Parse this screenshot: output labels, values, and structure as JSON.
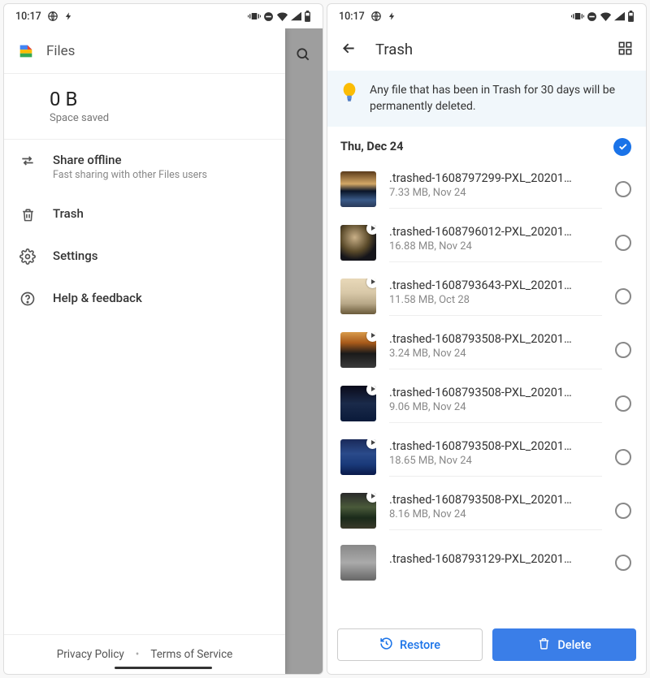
{
  "status": {
    "time": "10:17"
  },
  "left": {
    "header": {
      "title": "Files"
    },
    "space": {
      "value": "0 B",
      "label": "Space saved"
    },
    "items": [
      {
        "icon": "swap",
        "label": "Share offline",
        "sub": "Fast sharing with other Files users"
      },
      {
        "icon": "trash",
        "label": "Trash",
        "sub": ""
      },
      {
        "icon": "gear",
        "label": "Settings",
        "sub": ""
      },
      {
        "icon": "help",
        "label": "Help & feedback",
        "sub": ""
      }
    ],
    "footer": {
      "privacy": "Privacy Policy",
      "terms": "Terms of Service"
    }
  },
  "right": {
    "title": "Trash",
    "banner": "Any file that has been in Trash for 30 days will be permanently deleted.",
    "date": "Thu, Dec 24",
    "files": [
      {
        "name": ".trashed-1608797299-PXL_20201…",
        "sub": "7.33 MB, Nov 24",
        "thumb": "th0",
        "video": false
      },
      {
        "name": ".trashed-1608796012-PXL_20201…",
        "sub": "16.88 MB, Nov 24",
        "thumb": "th1",
        "video": true
      },
      {
        "name": ".trashed-1608793643-PXL_20201…",
        "sub": "11.58 MB, Oct 28",
        "thumb": "th2",
        "video": true
      },
      {
        "name": ".trashed-1608793508-PXL_20201…",
        "sub": "3.24 MB, Nov 24",
        "thumb": "th3",
        "video": true
      },
      {
        "name": ".trashed-1608793508-PXL_20201…",
        "sub": "9.06 MB, Nov 24",
        "thumb": "th4",
        "video": true
      },
      {
        "name": ".trashed-1608793508-PXL_20201…",
        "sub": "18.65 MB, Nov 24",
        "thumb": "th5",
        "video": true
      },
      {
        "name": ".trashed-1608793508-PXL_20201…",
        "sub": "8.16 MB, Nov 24",
        "thumb": "th6",
        "video": true
      },
      {
        "name": ".trashed-1608793129-PXL_20201…",
        "sub": "",
        "thumb": "th7",
        "video": false
      }
    ],
    "actions": {
      "restore": "Restore",
      "delete": "Delete"
    }
  }
}
